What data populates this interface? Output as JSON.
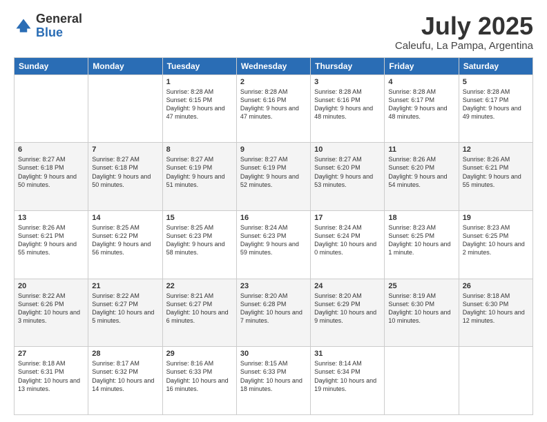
{
  "logo": {
    "general": "General",
    "blue": "Blue"
  },
  "header": {
    "title": "July 2025",
    "subtitle": "Caleufu, La Pampa, Argentina"
  },
  "weekdays": [
    "Sunday",
    "Monday",
    "Tuesday",
    "Wednesday",
    "Thursday",
    "Friday",
    "Saturday"
  ],
  "weeks": [
    [
      {
        "day": "",
        "info": ""
      },
      {
        "day": "",
        "info": ""
      },
      {
        "day": "1",
        "info": "Sunrise: 8:28 AM\nSunset: 6:15 PM\nDaylight: 9 hours and 47 minutes."
      },
      {
        "day": "2",
        "info": "Sunrise: 8:28 AM\nSunset: 6:16 PM\nDaylight: 9 hours and 47 minutes."
      },
      {
        "day": "3",
        "info": "Sunrise: 8:28 AM\nSunset: 6:16 PM\nDaylight: 9 hours and 48 minutes."
      },
      {
        "day": "4",
        "info": "Sunrise: 8:28 AM\nSunset: 6:17 PM\nDaylight: 9 hours and 48 minutes."
      },
      {
        "day": "5",
        "info": "Sunrise: 8:28 AM\nSunset: 6:17 PM\nDaylight: 9 hours and 49 minutes."
      }
    ],
    [
      {
        "day": "6",
        "info": "Sunrise: 8:27 AM\nSunset: 6:18 PM\nDaylight: 9 hours and 50 minutes."
      },
      {
        "day": "7",
        "info": "Sunrise: 8:27 AM\nSunset: 6:18 PM\nDaylight: 9 hours and 50 minutes."
      },
      {
        "day": "8",
        "info": "Sunrise: 8:27 AM\nSunset: 6:19 PM\nDaylight: 9 hours and 51 minutes."
      },
      {
        "day": "9",
        "info": "Sunrise: 8:27 AM\nSunset: 6:19 PM\nDaylight: 9 hours and 52 minutes."
      },
      {
        "day": "10",
        "info": "Sunrise: 8:27 AM\nSunset: 6:20 PM\nDaylight: 9 hours and 53 minutes."
      },
      {
        "day": "11",
        "info": "Sunrise: 8:26 AM\nSunset: 6:20 PM\nDaylight: 9 hours and 54 minutes."
      },
      {
        "day": "12",
        "info": "Sunrise: 8:26 AM\nSunset: 6:21 PM\nDaylight: 9 hours and 55 minutes."
      }
    ],
    [
      {
        "day": "13",
        "info": "Sunrise: 8:26 AM\nSunset: 6:21 PM\nDaylight: 9 hours and 55 minutes."
      },
      {
        "day": "14",
        "info": "Sunrise: 8:25 AM\nSunset: 6:22 PM\nDaylight: 9 hours and 56 minutes."
      },
      {
        "day": "15",
        "info": "Sunrise: 8:25 AM\nSunset: 6:23 PM\nDaylight: 9 hours and 58 minutes."
      },
      {
        "day": "16",
        "info": "Sunrise: 8:24 AM\nSunset: 6:23 PM\nDaylight: 9 hours and 59 minutes."
      },
      {
        "day": "17",
        "info": "Sunrise: 8:24 AM\nSunset: 6:24 PM\nDaylight: 10 hours and 0 minutes."
      },
      {
        "day": "18",
        "info": "Sunrise: 8:23 AM\nSunset: 6:25 PM\nDaylight: 10 hours and 1 minute."
      },
      {
        "day": "19",
        "info": "Sunrise: 8:23 AM\nSunset: 6:25 PM\nDaylight: 10 hours and 2 minutes."
      }
    ],
    [
      {
        "day": "20",
        "info": "Sunrise: 8:22 AM\nSunset: 6:26 PM\nDaylight: 10 hours and 3 minutes."
      },
      {
        "day": "21",
        "info": "Sunrise: 8:22 AM\nSunset: 6:27 PM\nDaylight: 10 hours and 5 minutes."
      },
      {
        "day": "22",
        "info": "Sunrise: 8:21 AM\nSunset: 6:27 PM\nDaylight: 10 hours and 6 minutes."
      },
      {
        "day": "23",
        "info": "Sunrise: 8:20 AM\nSunset: 6:28 PM\nDaylight: 10 hours and 7 minutes."
      },
      {
        "day": "24",
        "info": "Sunrise: 8:20 AM\nSunset: 6:29 PM\nDaylight: 10 hours and 9 minutes."
      },
      {
        "day": "25",
        "info": "Sunrise: 8:19 AM\nSunset: 6:30 PM\nDaylight: 10 hours and 10 minutes."
      },
      {
        "day": "26",
        "info": "Sunrise: 8:18 AM\nSunset: 6:30 PM\nDaylight: 10 hours and 12 minutes."
      }
    ],
    [
      {
        "day": "27",
        "info": "Sunrise: 8:18 AM\nSunset: 6:31 PM\nDaylight: 10 hours and 13 minutes."
      },
      {
        "day": "28",
        "info": "Sunrise: 8:17 AM\nSunset: 6:32 PM\nDaylight: 10 hours and 14 minutes."
      },
      {
        "day": "29",
        "info": "Sunrise: 8:16 AM\nSunset: 6:33 PM\nDaylight: 10 hours and 16 minutes."
      },
      {
        "day": "30",
        "info": "Sunrise: 8:15 AM\nSunset: 6:33 PM\nDaylight: 10 hours and 18 minutes."
      },
      {
        "day": "31",
        "info": "Sunrise: 8:14 AM\nSunset: 6:34 PM\nDaylight: 10 hours and 19 minutes."
      },
      {
        "day": "",
        "info": ""
      },
      {
        "day": "",
        "info": ""
      }
    ]
  ]
}
